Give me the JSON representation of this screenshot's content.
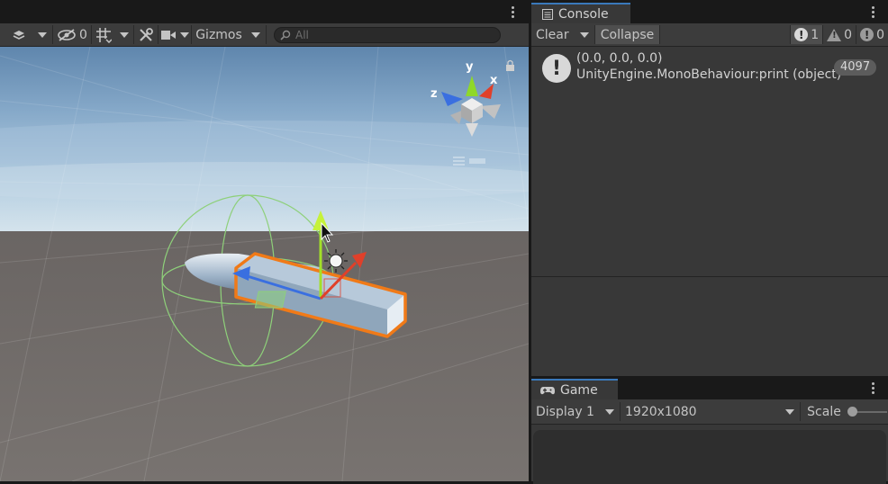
{
  "scene": {
    "hidden_count": "0",
    "gizmos_label": "Gizmos",
    "search_placeholder": "All",
    "axis_labels": {
      "x": "x",
      "y": "y",
      "z": "z"
    }
  },
  "console": {
    "tab_label": "Console",
    "clear_label": "Clear",
    "collapse_label": "Collapse",
    "log_count": "1",
    "warning_count": "0",
    "error_count": "0",
    "entries": [
      {
        "line1": "(0.0, 0.0, 0.0)",
        "line2": "UnityEngine.MonoBehaviour:print (object)",
        "count": "4097"
      }
    ]
  },
  "game": {
    "tab_label": "Game",
    "display_label": "Display 1",
    "resolution_label": "1920x1080",
    "scale_label": "Scale"
  },
  "colors": {
    "accent": "#3a79bb",
    "selection_outline": "#f07a18",
    "axis_x": "#e0402a",
    "axis_y": "#a3e028",
    "axis_z": "#3a6fe0"
  }
}
